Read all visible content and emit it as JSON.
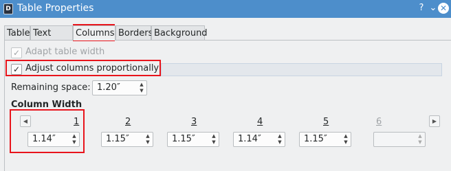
{
  "window": {
    "title": "Table Properties",
    "app_icon": "writer-doc-icon",
    "help": "?",
    "collapse": "⌄",
    "close": "✕"
  },
  "tabs": [
    {
      "label": "Table"
    },
    {
      "label": "Text Flow"
    },
    {
      "label": "Columns",
      "active": true
    },
    {
      "label": "Borders"
    },
    {
      "label": "Background"
    }
  ],
  "options": {
    "adapt_width": {
      "label": "Adapt table width",
      "checked": true,
      "enabled": false
    },
    "adjust_proportionally": {
      "label": "Adjust columns proportionally",
      "checked": true,
      "enabled": true
    }
  },
  "remaining_space": {
    "label": "Remaining space:",
    "value": "1.20″"
  },
  "column_width": {
    "title": "Column Width",
    "columns": [
      {
        "number": "1",
        "value": "1.14″"
      },
      {
        "number": "2",
        "value": "1.15″"
      },
      {
        "number": "3",
        "value": "1.15″"
      },
      {
        "number": "4",
        "value": "1.14″"
      },
      {
        "number": "5",
        "value": "1.15″"
      },
      {
        "number": "6",
        "value": "",
        "enabled": false
      }
    ]
  },
  "colors": {
    "titlebar": "#4d8ecb",
    "highlight": "#e8141b"
  }
}
